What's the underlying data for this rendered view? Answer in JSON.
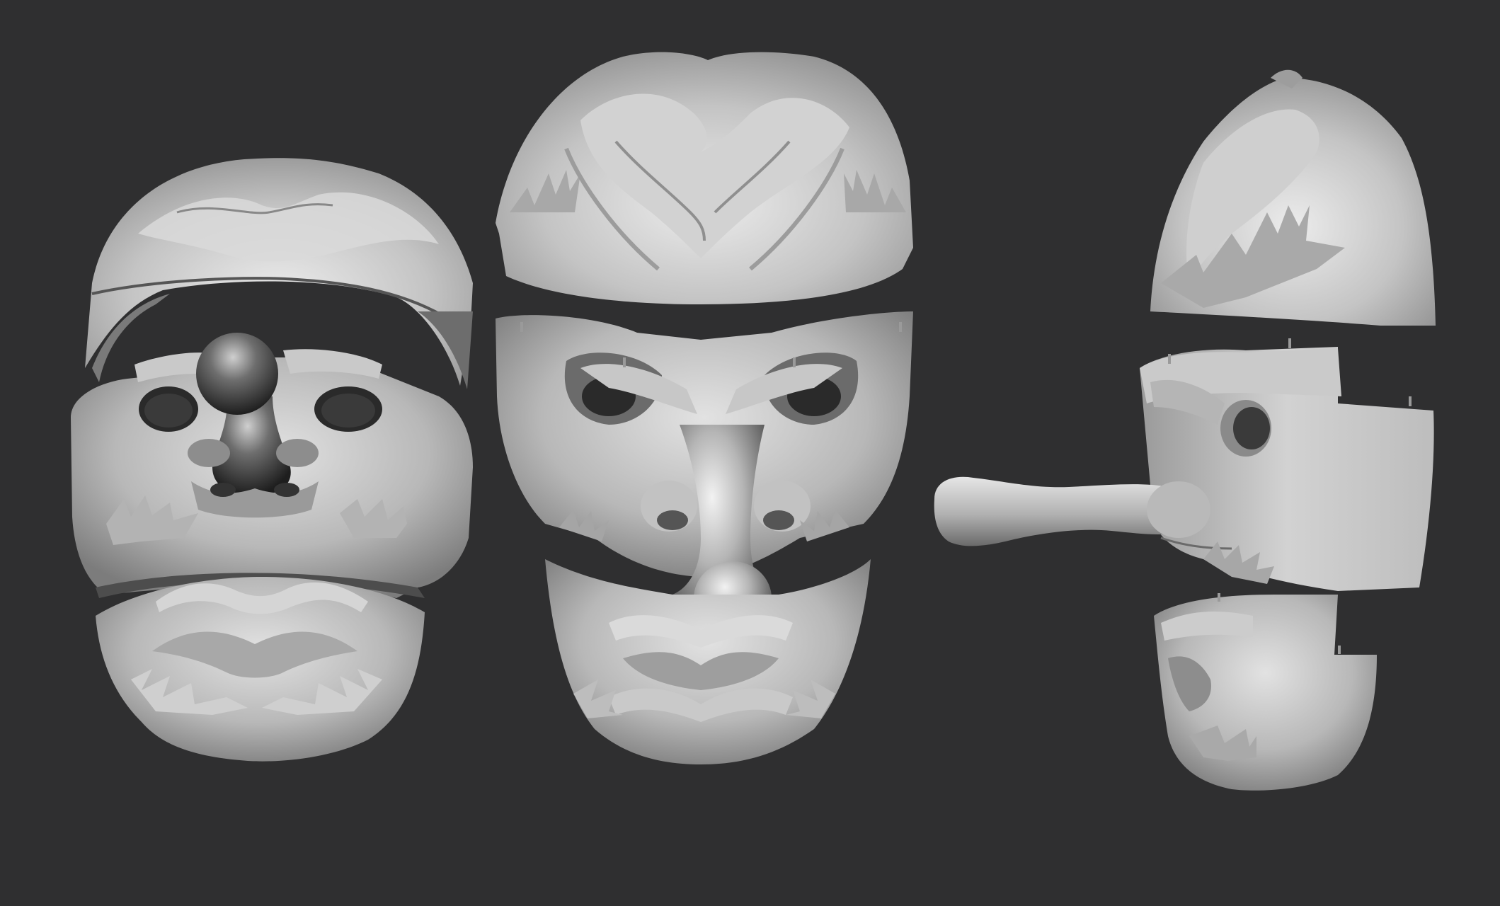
{
  "image": {
    "kind": "3d-render",
    "subject": "tengu-mask-exploded-parts",
    "background_color": "#2f2f30",
    "base_material_color": "#bdbdbd",
    "shadow_color": "#1b1b1b",
    "highlight_color": "#efefef"
  },
  "views": [
    {
      "name": "front-view",
      "parts": [
        "forehead",
        "nose-and-eyes",
        "chin"
      ]
    },
    {
      "name": "three-quarter-view",
      "parts": [
        "forehead",
        "nose-and-eyes",
        "chin"
      ]
    },
    {
      "name": "side-view",
      "parts": [
        "forehead",
        "nose-and-eyes",
        "chin"
      ]
    }
  ]
}
